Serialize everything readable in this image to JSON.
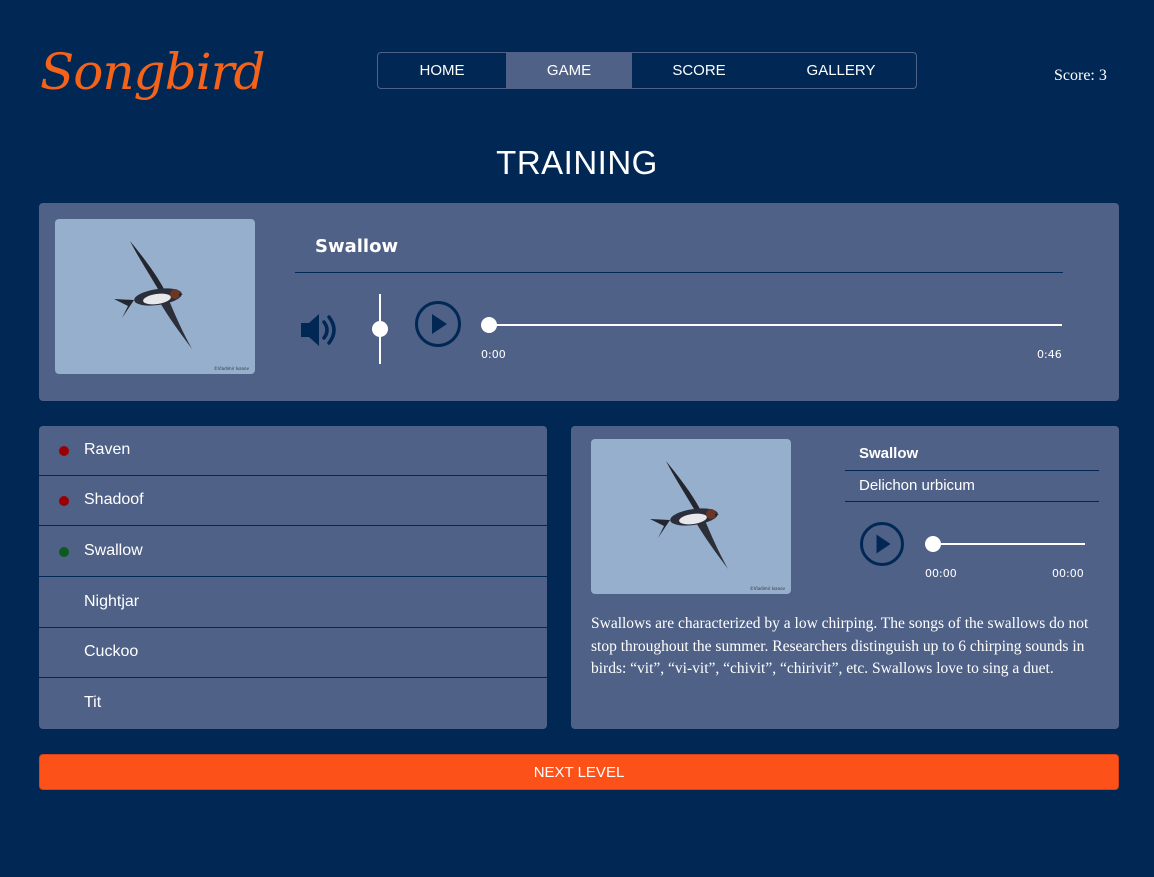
{
  "header": {
    "logo": "Songbird",
    "nav": [
      "HOME",
      "GAME",
      "SCORE",
      "GALLERY"
    ],
    "active_nav": "GAME",
    "score_text": "Score: 3"
  },
  "section_title": "TRAINING",
  "player": {
    "bird_name": "Swallow",
    "time_current": "0:00",
    "time_total": "0:46",
    "volume_level": 0.5,
    "progress": 0
  },
  "answers": [
    {
      "label": "Raven",
      "status": "wrong",
      "dot_color": "#9a0000"
    },
    {
      "label": "Shadoof",
      "status": "wrong",
      "dot_color": "#9a0000"
    },
    {
      "label": "Swallow",
      "status": "correct",
      "dot_color": "#0d5a1e"
    },
    {
      "label": "Nightjar",
      "status": "none"
    },
    {
      "label": "Cuckoo",
      "status": "none"
    },
    {
      "label": "Tit",
      "status": "none"
    }
  ],
  "info": {
    "name": "Swallow",
    "latin": "Delichon urbicum",
    "time_current": "00:00",
    "time_total": "00:00",
    "progress": 0,
    "description": "Swallows are characterized by a low chirping. The songs of the swallows do not stop throughout the summer. Researchers distinguish up to 6 chirping sounds in birds: “vit”, “vi-vit”, “chivit”, “chirivit”, etc. Swallows love to sing a duet."
  },
  "next_button": "NEXT LEVEL",
  "colors": {
    "background": "#012855",
    "panel": "#4f6187",
    "accent": "#fd511a",
    "logo": "#f5621a",
    "photo_sky": "#95afcd"
  },
  "icons": [
    "volume-icon",
    "play-icon",
    "bird-photo"
  ]
}
